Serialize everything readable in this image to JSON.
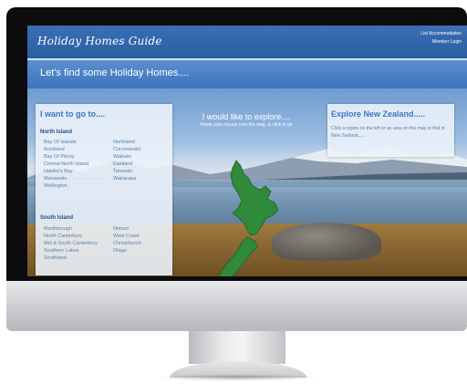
{
  "site": {
    "logo": "Holiday Homes Guide",
    "header_links": [
      "List Accommodation",
      "Member Login"
    ],
    "banner_title": "Let's find some Holiday Homes...."
  },
  "left_panel": {
    "title": "I want to go to....",
    "north_island": {
      "title": "North Island",
      "col1": [
        "Bay Of Islands",
        "Auckland",
        "Bay Of Plenty",
        "Central North Island",
        "Hawke's Bay",
        "Manawatu",
        "Wellington"
      ],
      "col2": [
        "Northland",
        "Coromandel",
        "Waikato",
        "Eastland",
        "Taranaki",
        "Wairarapa"
      ]
    },
    "south_island": {
      "title": "South Island",
      "col1": [
        "Marlborough",
        "North Canterbury",
        "Mid & South Canterbury",
        "Southern Lakes",
        "Southland"
      ],
      "col2": [
        "Nelson",
        "West Coast",
        "Christchurch",
        "Otago"
      ]
    }
  },
  "center": {
    "title": "I would like to explore....",
    "subtitle": "Hover your mouse over the map, & click to go"
  },
  "right_panel": {
    "title": "Explore New Zealand.....",
    "text": "Click a region on the left or an area on the map to find in New Zealand......"
  },
  "colors": {
    "header_blue": "#2a5ea0",
    "banner_blue": "#3d74bd",
    "panel_title": "#3a78c6",
    "map_green": "#2f8a3a"
  }
}
